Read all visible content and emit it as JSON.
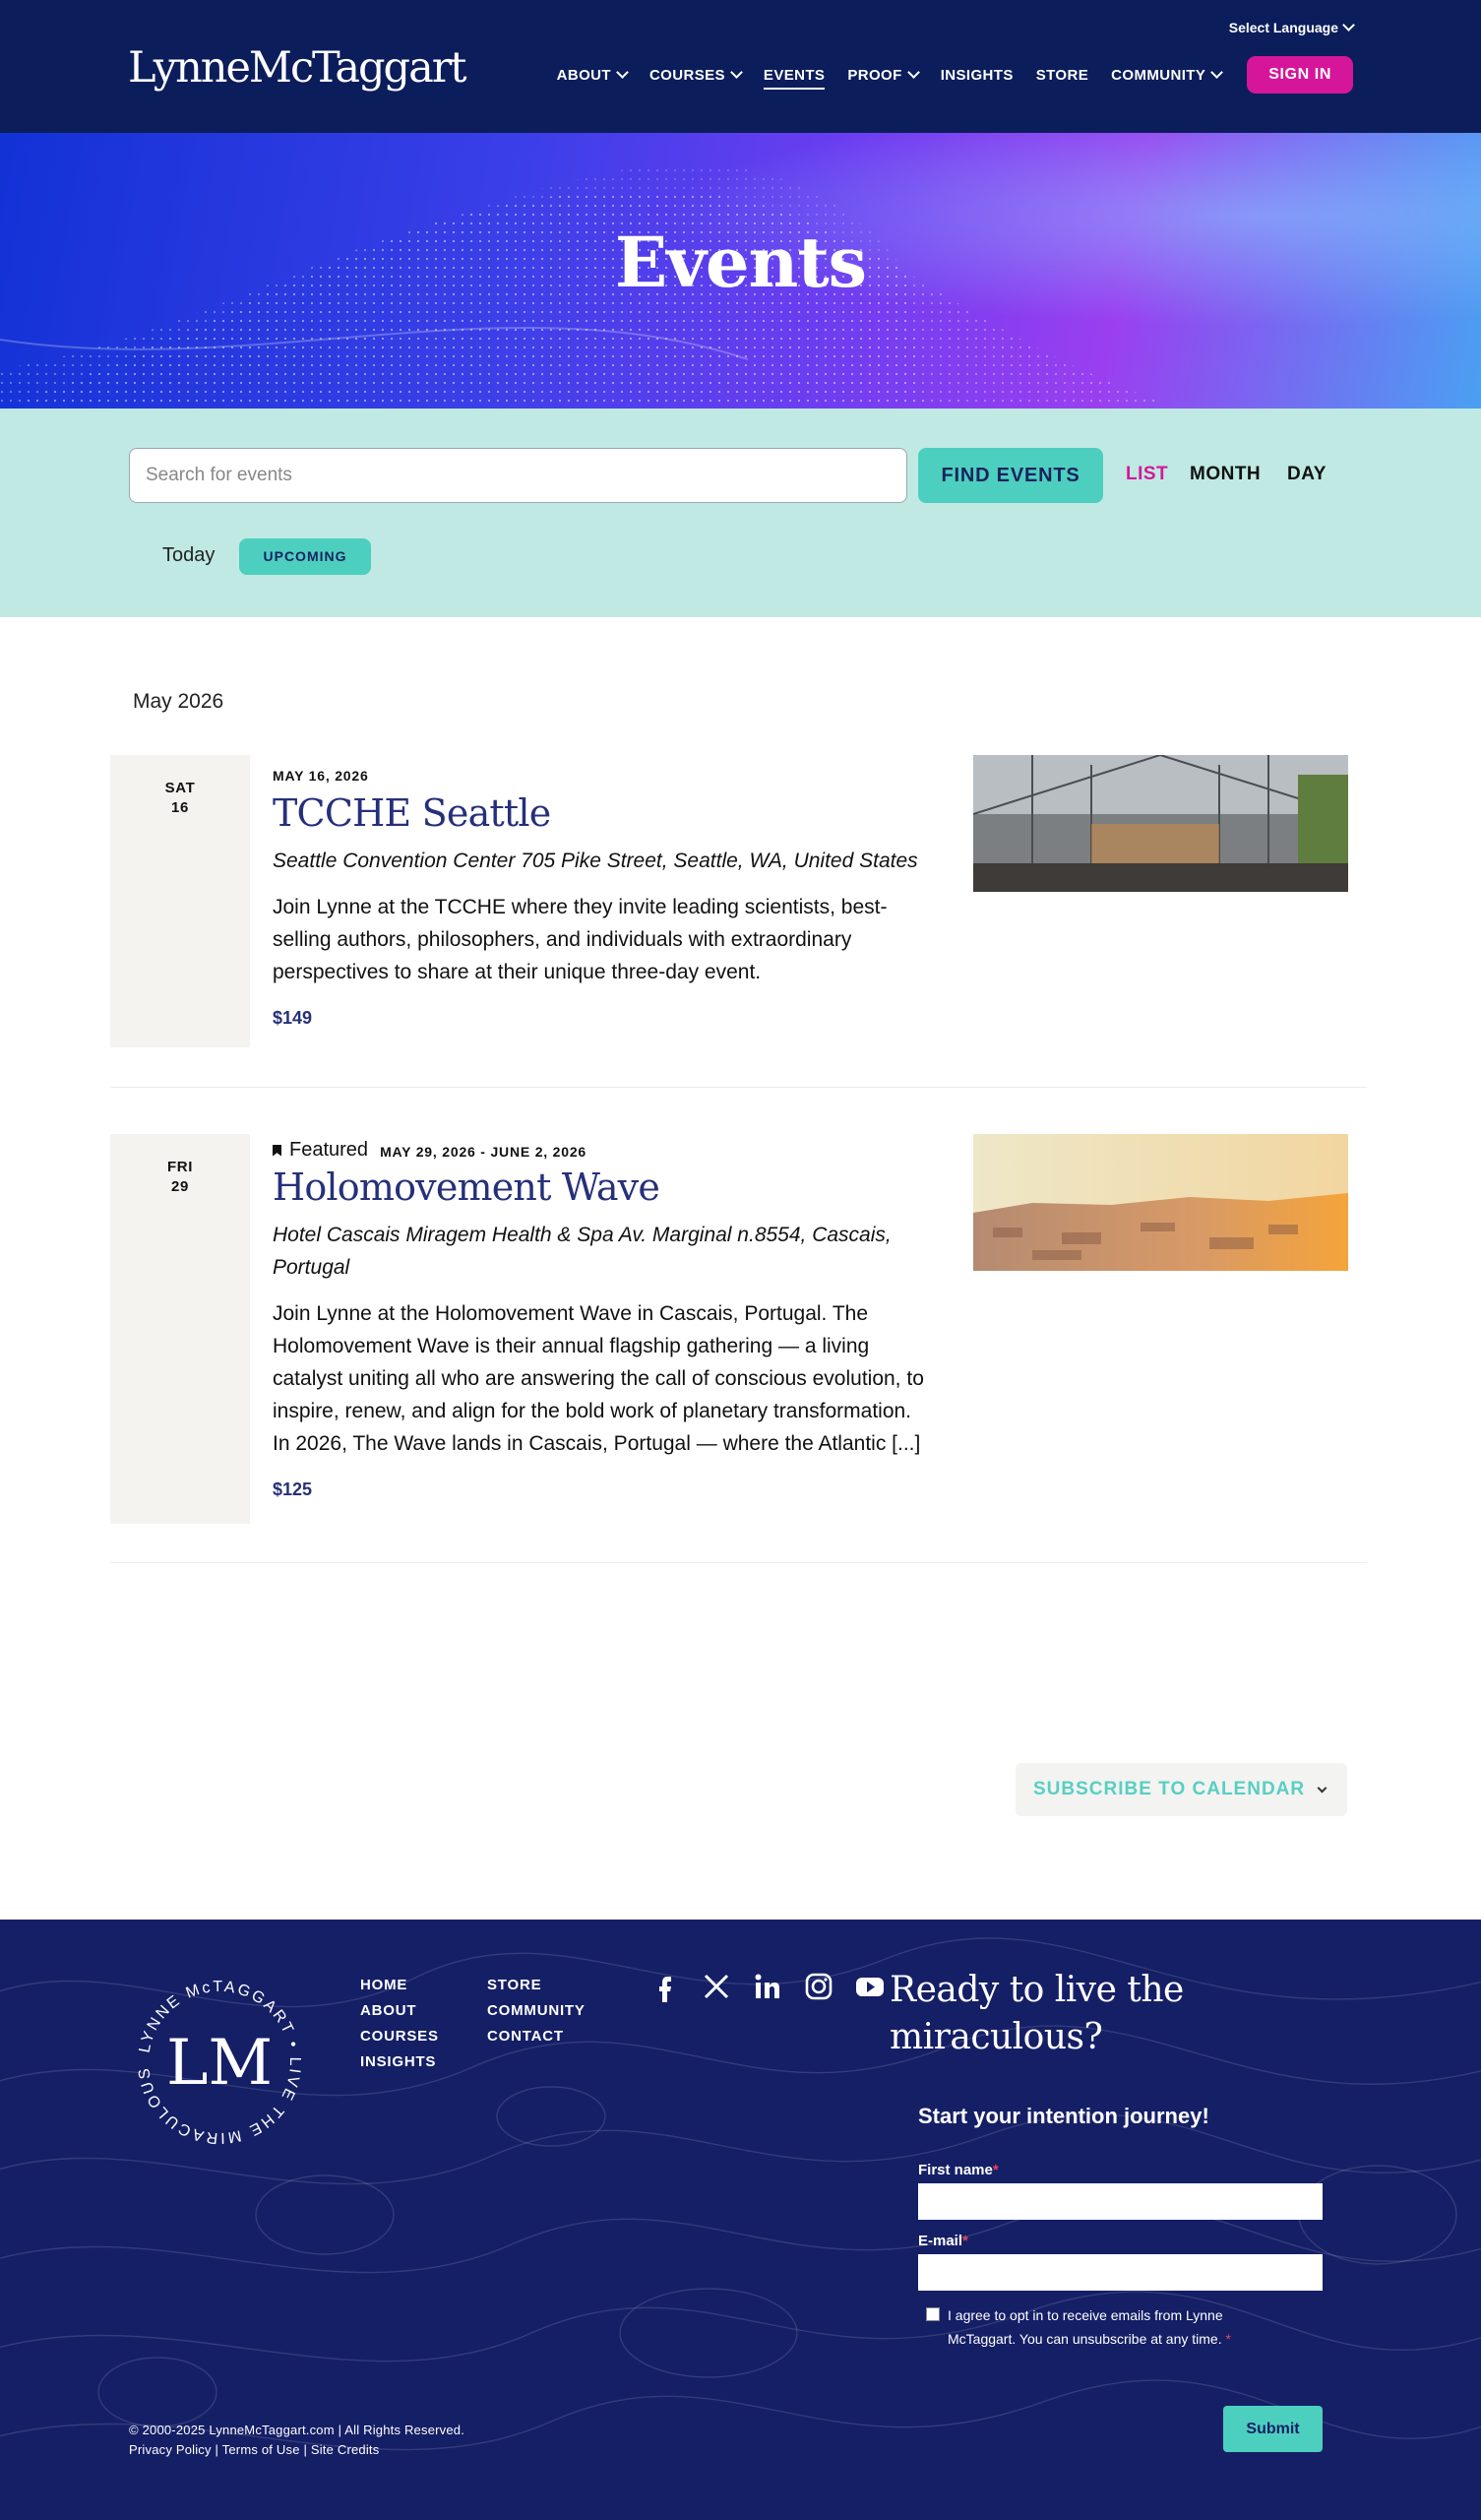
{
  "header": {
    "logo_text": "LynneMcTaggart",
    "language_label": "Select Language",
    "nav": [
      {
        "label": "ABOUT",
        "dropdown": true
      },
      {
        "label": "COURSES",
        "dropdown": true
      },
      {
        "label": "EVENTS",
        "dropdown": false,
        "active": true
      },
      {
        "label": "PROOF",
        "dropdown": true
      },
      {
        "label": "INSIGHTS",
        "dropdown": false
      },
      {
        "label": "STORE",
        "dropdown": false
      },
      {
        "label": "COMMUNITY",
        "dropdown": true
      }
    ],
    "sign_in_label": "SIGN IN"
  },
  "hero": {
    "title": "Events"
  },
  "filters": {
    "search_placeholder": "Search for events",
    "find_label": "FIND EVENTS",
    "views": [
      "LIST",
      "MONTH",
      "DAY"
    ],
    "active_view": "LIST",
    "today_label": "Today",
    "upcoming_label": "UPCOMING"
  },
  "events_list": {
    "month_heading": "May 2026",
    "events": [
      {
        "weekday": "SAT",
        "day": "16",
        "featured_label": "",
        "date_text": "MAY 16, 2026",
        "title": "TCCHE Seattle",
        "venue": "Seattle Convention Center 705 Pike Street, Seattle, WA, United States",
        "description": "Join Lynne at the TCCHE where they invite leading scientists, best-selling authors, philosophers, and individuals with extraordinary perspectives to share at their unique three-day event.",
        "price": "$149"
      },
      {
        "weekday": "FRI",
        "day": "29",
        "featured_label": "Featured",
        "date_text": "MAY 29, 2026 - JUNE 2, 2026",
        "title": "Holomovement Wave",
        "venue": "Hotel Cascais Miragem Health & Spa Av. Marginal n.8554, Cascais, Portugal",
        "description": "Join Lynne at the Holomovement Wave in Cascais, Portugal. The Holomovement Wave is their annual flagship gathering — a living catalyst uniting all who are answering the call of conscious evolution, to inspire, renew, and align for the bold work of planetary transformation. In 2026, The Wave lands in Cascais, Portugal — where the Atlantic [...]",
        "price": "$125"
      }
    ]
  },
  "subscribe_label": "SUBSCRIBE TO CALENDAR",
  "footer": {
    "badge_text": "LYNNE McTAGGART • LIVE THE MIRACULOUS •",
    "badge_monogram": "LM",
    "links_col1": [
      "HOME",
      "ABOUT",
      "COURSES",
      "INSIGHTS"
    ],
    "links_col2": [
      "STORE",
      "COMMUNITY",
      "CONTACT"
    ],
    "socials": [
      "facebook-icon",
      "x-icon",
      "linkedin-icon",
      "instagram-icon",
      "youtube-icon"
    ],
    "ready_heading": "Ready to live the miraculous?",
    "form_title": "Start your intention journey!",
    "first_name_label": "First name",
    "email_label": "E-mail",
    "required_mark": "*",
    "consent_text": "I agree to opt in to receive emails from Lynne McTaggart. You can unsubscribe at any time.",
    "submit_label": "Submit",
    "copyright": "© 2000-2025 LynneMcTaggart.com | All Rights Reserved.",
    "legal_links": "Privacy Policy | Terms of Use | Site Credits"
  },
  "colors": {
    "header_bg": "#0c1d5b",
    "accent_pink": "#d6169a",
    "accent_teal": "#4dcfbf",
    "filter_bg": "#bfe9e2",
    "title_blue": "#26307a",
    "footer_bg": "#151f66"
  }
}
